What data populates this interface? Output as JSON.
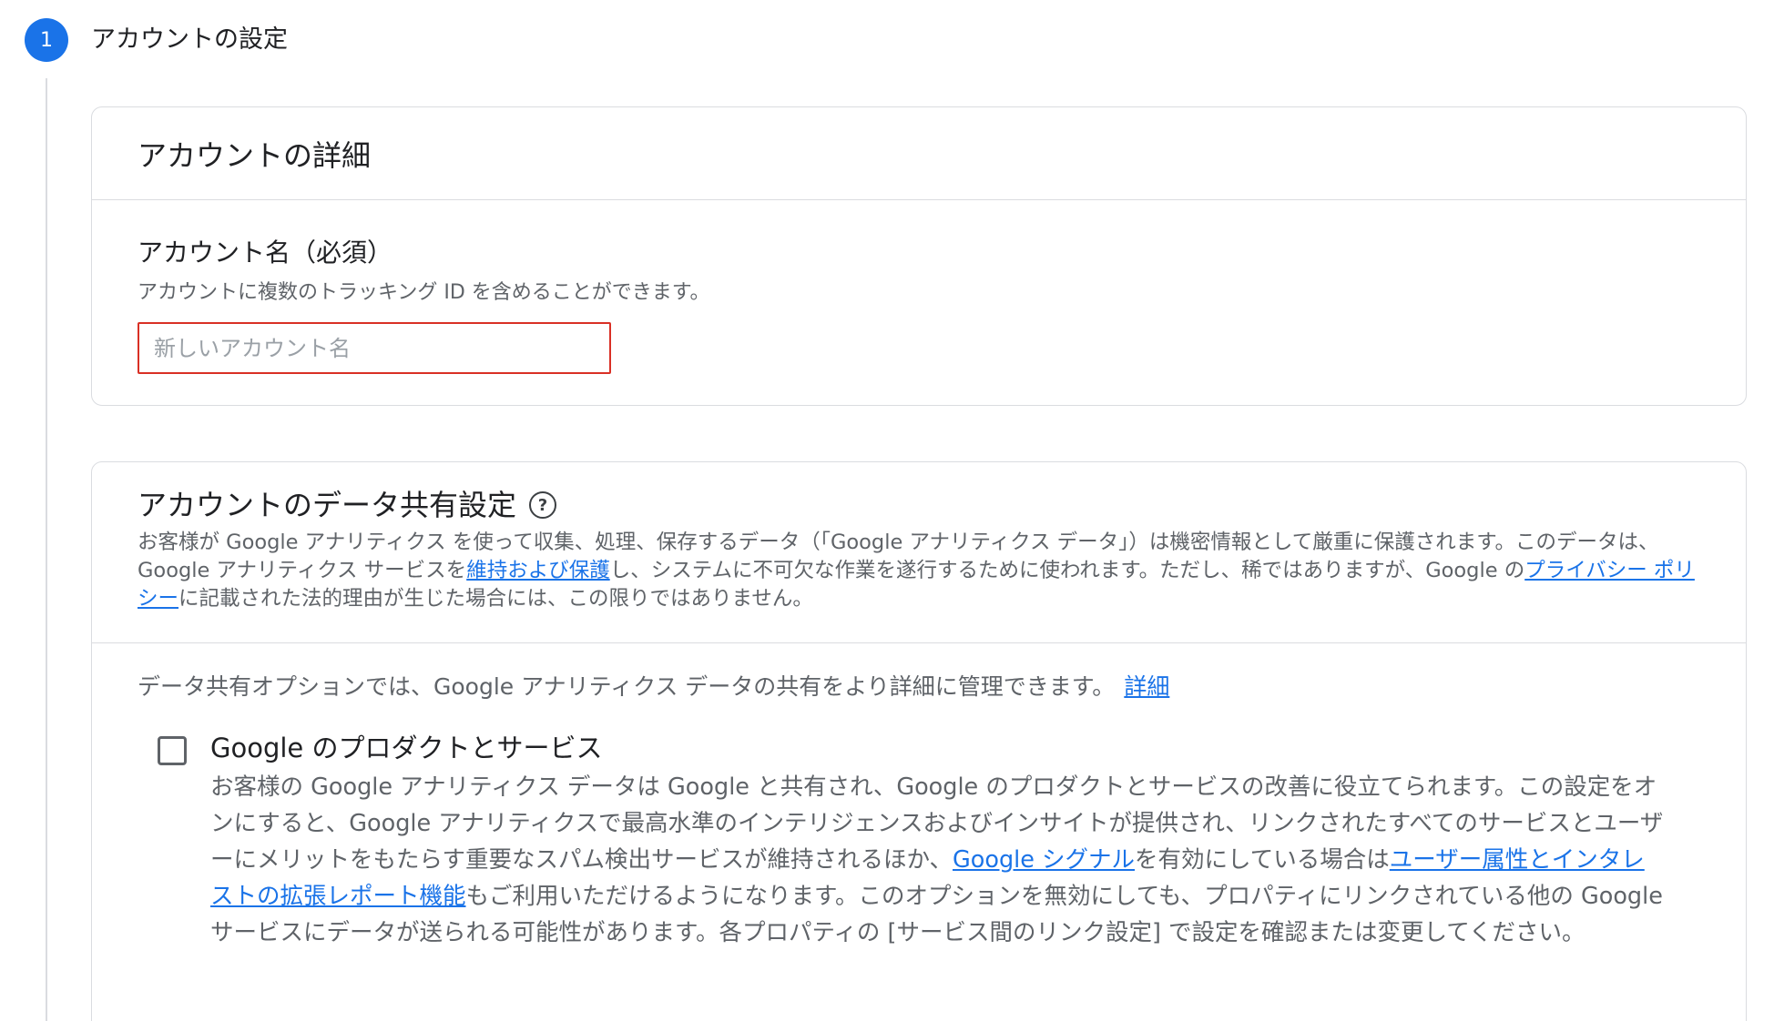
{
  "step": {
    "number": "1",
    "title": "アカウントの設定"
  },
  "account_details": {
    "header": "アカウントの詳細",
    "field_label": "アカウント名（必須）",
    "field_help": "アカウントに複数のトラッキング ID を含めることができます。",
    "input_placeholder": "新しいアカウント名",
    "input_value": ""
  },
  "data_sharing": {
    "header": "アカウントのデータ共有設定",
    "help_icon": "help-circle-icon",
    "desc_part1": "お客様が Google アナリティクス を使って収集、処理、保存するデータ（「Google アナリティクス データ」）は機密情報として厳重に保護されます。このデータは、Google アナリティクス サービスを",
    "desc_link1": "維持および保護",
    "desc_part2": "し、システムに不可欠な作業を遂行するために使われます。ただし、稀ではありますが、Google の",
    "desc_link2": "プライバシー ポリシー",
    "desc_part3": "に記載された法的理由が生じた場合には、この限りではありません。",
    "intro_text": "データ共有オプションでは、Google アナリティクス データの共有をより詳細に管理できます。",
    "intro_link": "詳細",
    "option": {
      "title": "Google のプロダクトとサービス",
      "checked": false,
      "desc_part1": "お客様の Google アナリティクス データは Google と共有され、Google のプロダクトとサービスの改善に役立てられます。この設定をオンにすると、Google アナリティクスで最高水準のインテリジェンスおよびインサイトが提供され、リンクされたすべてのサービスとユーザーにメリットをもたらす重要なスパム検出サービスが維持されるほか、",
      "desc_link1": "Google シグナル",
      "desc_part2": "を有効にしている場合は",
      "desc_link2": "ユーザー属性とインタレストの拡張レポート機能",
      "desc_part3": "もご利用いただけるようになります。このオプションを無効にしても、プロパティにリンクされている他の Google サービスにデータが送られる可能性があります。各プロパティの [サービス間のリンク設定] で設定を確認または変更してください。"
    }
  },
  "colors": {
    "accent": "#1a73e8",
    "error_border": "#d93025",
    "secondary_text": "#5f6368",
    "divider": "#dadce0"
  }
}
